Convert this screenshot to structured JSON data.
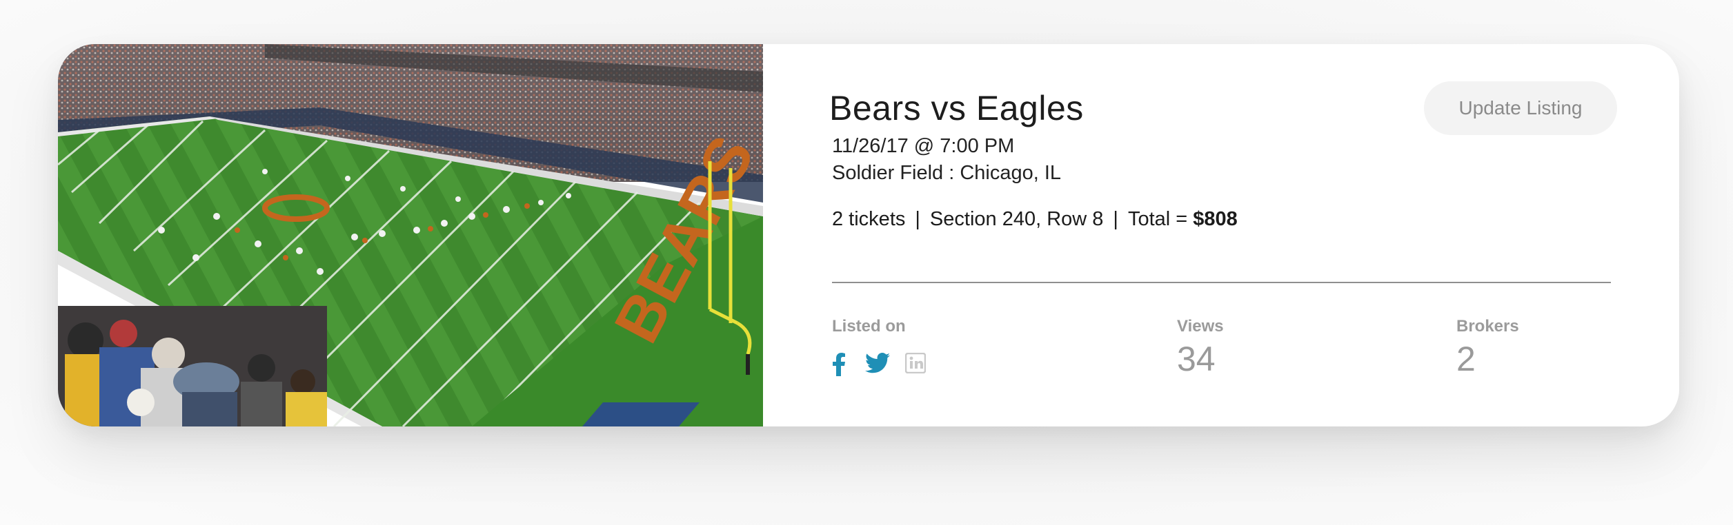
{
  "listing": {
    "title": "Bears vs Eagles",
    "datetime": "11/26/17 @ 7:00 PM",
    "venue": "Soldier Field : Chicago, IL",
    "tickets": "2 tickets",
    "section": "Section 240, Row 8",
    "total_prefix": "Total =",
    "total_value": "$808",
    "separator": "|",
    "photo_alt": "Football stadium field photo"
  },
  "actions": {
    "update_label": "Update Listing"
  },
  "stats": {
    "listed_on_label": "Listed on",
    "views_label": "Views",
    "views_value": "34",
    "brokers_label": "Brokers",
    "brokers_value": "2"
  },
  "social": [
    {
      "name": "facebook-icon",
      "active": true,
      "color": "#1f8fb6"
    },
    {
      "name": "twitter-icon",
      "active": true,
      "color": "#1f8fb6"
    },
    {
      "name": "linkedin-icon",
      "active": false,
      "color": "#c9c9c9"
    }
  ],
  "colors": {
    "accent": "#1f8fb6",
    "field": "#3f8c2f",
    "bears_orange": "#c4661e"
  }
}
